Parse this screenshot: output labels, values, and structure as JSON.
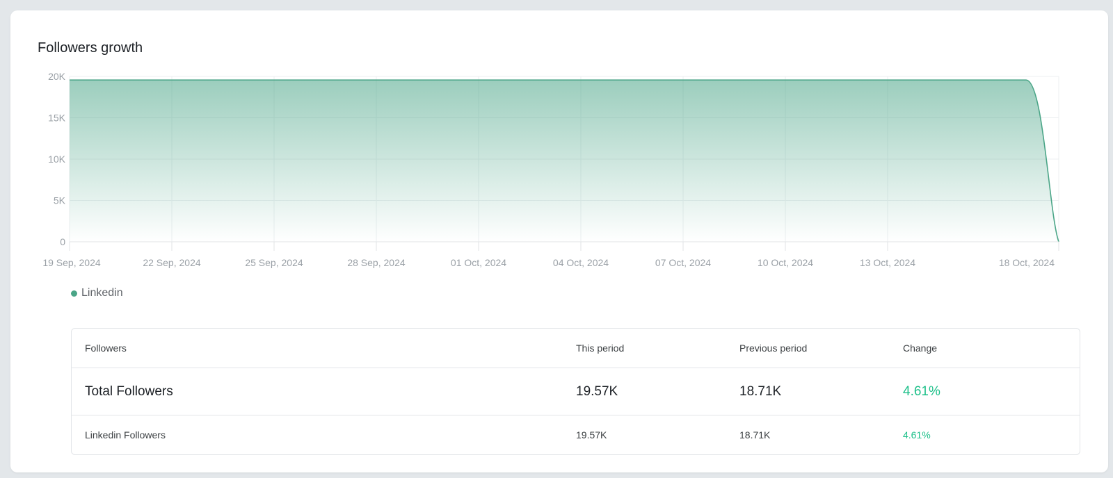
{
  "title": "Followers growth",
  "colors": {
    "series": "#4aa587",
    "positive": "#1ec08a"
  },
  "chart_data": {
    "type": "area",
    "title": "Followers growth",
    "xlabel": "",
    "ylabel": "",
    "ylim": [
      0,
      20000
    ],
    "yticks": [
      0,
      5000,
      10000,
      15000,
      20000
    ],
    "ytick_labels": [
      "0",
      "5K",
      "10K",
      "15K",
      "20K"
    ],
    "xtick_labels": [
      "19 Sep, 2024",
      "22 Sep, 2024",
      "25 Sep, 2024",
      "28 Sep, 2024",
      "01 Oct, 2024",
      "04 Oct, 2024",
      "07 Oct, 2024",
      "10 Oct, 2024",
      "13 Oct, 2024",
      "18 Oct, 2024"
    ],
    "grid": true,
    "legend_position": "bottom-left",
    "series": [
      {
        "name": "Linkedin",
        "x": [
          "19 Sep, 2024",
          "17 Oct, 2024",
          "18 Oct, 2024"
        ],
        "values": [
          19570,
          19570,
          0
        ]
      }
    ]
  },
  "table": {
    "headers": [
      "Followers",
      "This period",
      "Previous period",
      "Change"
    ],
    "rows": [
      [
        "Total Followers",
        "19.57K",
        "18.71K",
        "4.61%"
      ],
      [
        "Linkedin Followers",
        "19.57K",
        "18.71K",
        "4.61%"
      ]
    ]
  }
}
